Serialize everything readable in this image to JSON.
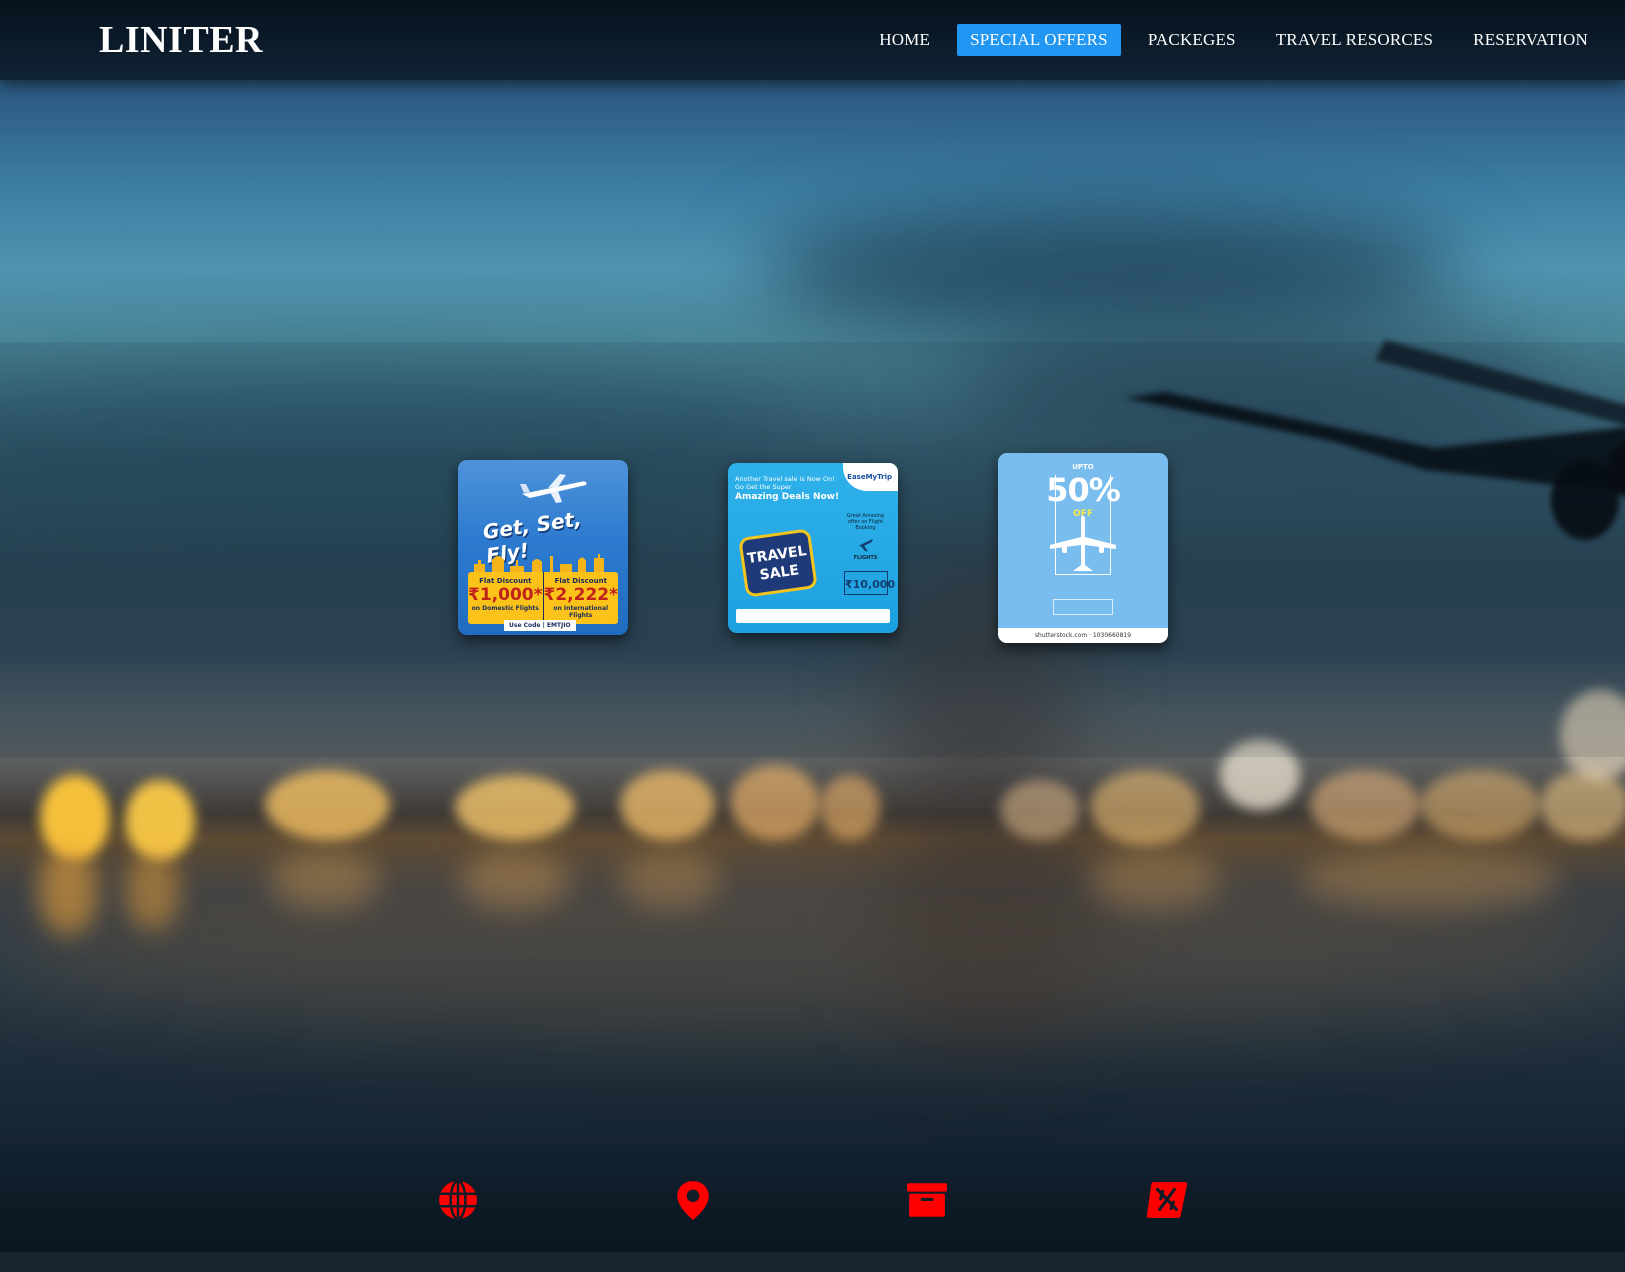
{
  "header": {
    "logo": "LINITER",
    "nav": [
      {
        "label": "HOME",
        "active": false
      },
      {
        "label": "SPECIAL OFFERS",
        "active": true
      },
      {
        "label": "PACKEGES",
        "active": false
      },
      {
        "label": "TRAVEL RESORCES",
        "active": false
      },
      {
        "label": "RESERVATION",
        "active": false
      }
    ]
  },
  "offers": [
    {
      "title": "Get, Set, Fly!",
      "left_small": "Flat Discount",
      "left_amount": "₹1,000*",
      "left_sub": "on Domestic Flights",
      "right_small": "Flat Discount",
      "right_amount": "₹2,222*",
      "right_sub": "on International Flights",
      "code": "Use Code | EMTJIO"
    },
    {
      "head_line1": "Another Travel sale is Now On!",
      "head_line2": "Go Get the Super",
      "head_bold": "Amazing Deals Now!",
      "brand": "EaseMyTrip",
      "badge": "TRAVEL SALE",
      "right_text": "Great Amazing offer on Flight Booking",
      "right_label": "FLIGHTS",
      "amount": "₹10,000"
    },
    {
      "upto": "UPTO",
      "percent": "50%",
      "off": "OFF",
      "stock": "shutterstock.com · 1030660819"
    }
  ],
  "footer": {
    "icons": [
      "globe-icon",
      "location-pin-icon",
      "archive-box-icon",
      "flight-ticket-icon"
    ]
  },
  "colors": {
    "accent": "#2196f3",
    "footer_icon": "#ff0000"
  }
}
